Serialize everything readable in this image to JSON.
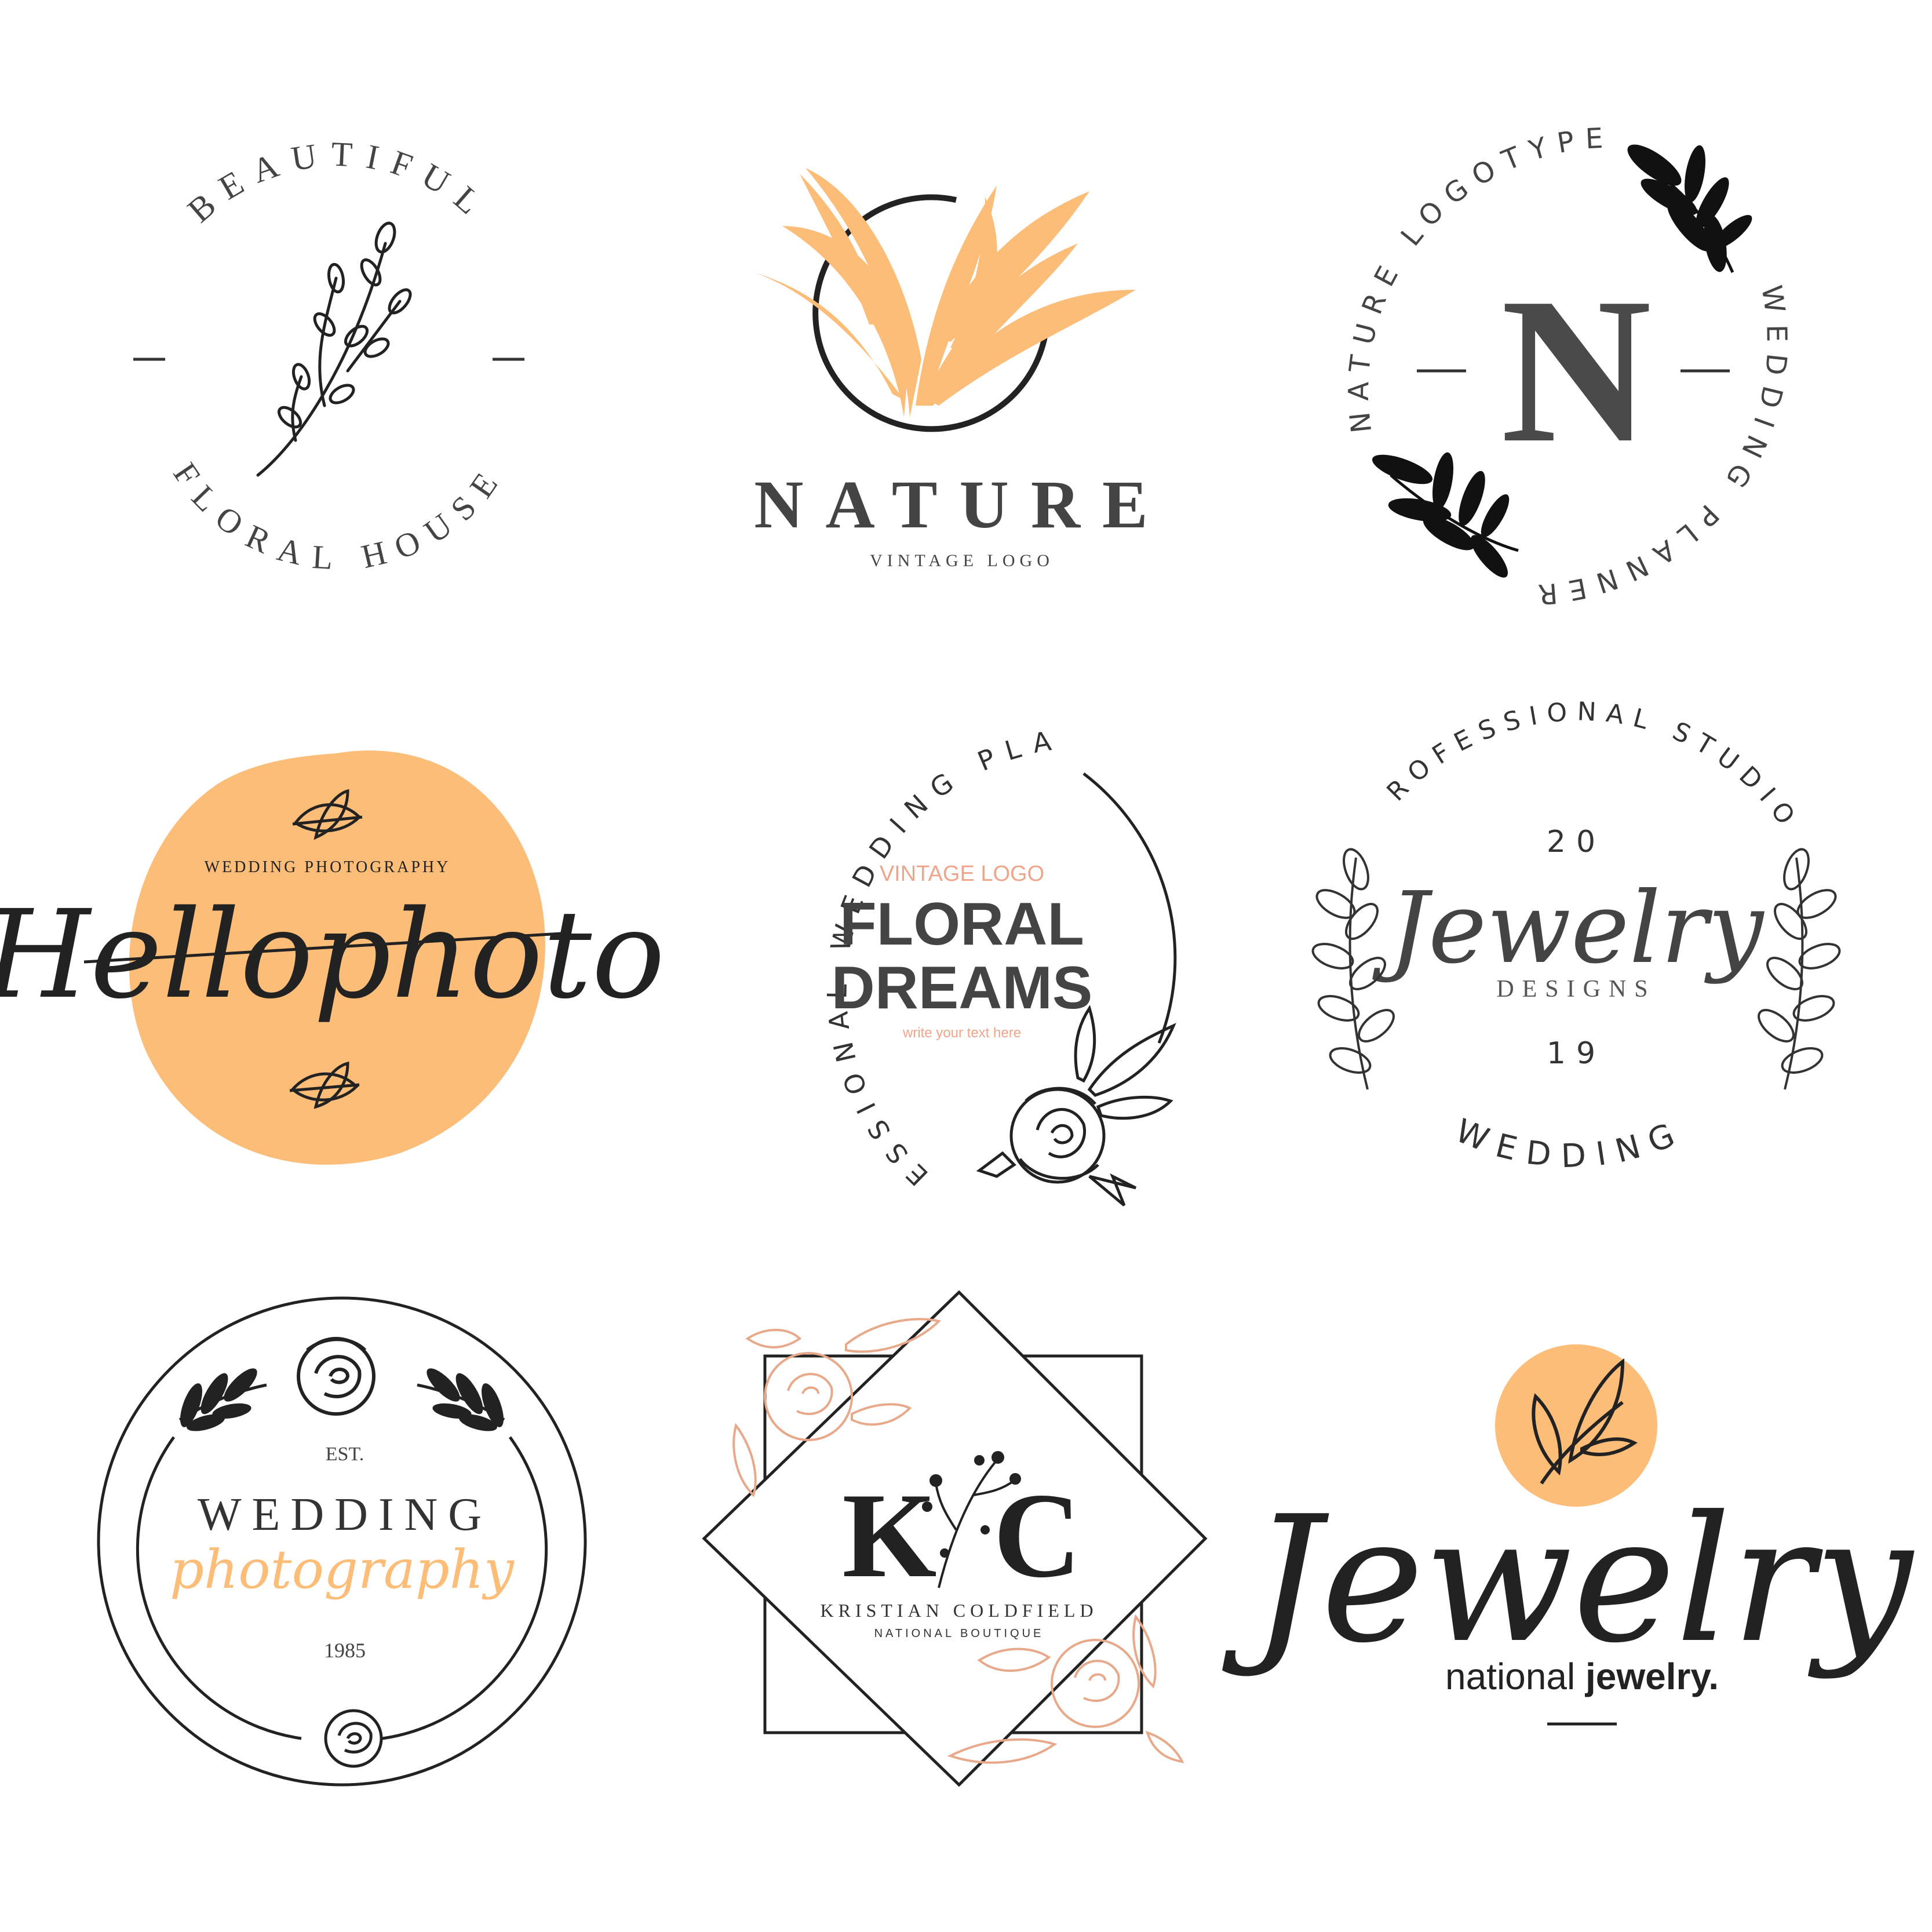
{
  "colors": {
    "ink": "#222222",
    "dark_gray": "#4a4a4a",
    "peach": "#fcbd79",
    "rose_gold": "#e8a88a",
    "salmon_text": "#f0a48a"
  },
  "logos": {
    "beautiful_floral_house": {
      "top_arc": "BEAUTIFUL",
      "bottom_arc": "FLORAL HOUSE",
      "icon": "branch-icon"
    },
    "nature_vintage": {
      "title": "NATURE",
      "subtitle": "VINTAGE LOGO",
      "icon": "leaves-icon"
    },
    "n_monogram": {
      "letter": "N",
      "left_arc": "NATURE LOGOTYPE",
      "right_arc": "WEDDING PLANNER",
      "icon": "leaf-sprig-icon"
    },
    "hellophoto": {
      "small_caption": "WEDDING PHOTOGRAPHY",
      "script_title": "Hellophoto",
      "icon": "leaf-pair-icon"
    },
    "floral_dreams": {
      "arc_text": "PROFESSIONAL WEDDING PLANNER",
      "kicker": "VINTAGE LOGO",
      "title_line1": "FLORAL",
      "title_line2": "DREAMS",
      "tagline": "write your text here",
      "icon": "rose-icon"
    },
    "jewelry_designs": {
      "top_arc": "PROFESSIONAL STUDIO",
      "year_top": "20",
      "script_title": "Jewelry",
      "subtitle": "DESIGNS",
      "year_bottom": "19",
      "bottom_arc": "WEDDING",
      "icon": "laurel-icon"
    },
    "wedding_photography": {
      "est": "EST.",
      "title": "WEDDING",
      "script_subtitle": "photography",
      "year": "1985",
      "icon": "rose-icon"
    },
    "kc_monogram": {
      "letter_left": "K",
      "letter_right": "C",
      "name": "KRISTIAN COLDFIELD",
      "subname": "NATIONAL BOUTIQUE",
      "icon": "floral-corner-icon"
    },
    "jewelry_national": {
      "script_title": "Jewelry",
      "tag_regular": "national ",
      "tag_bold": "jewelry.",
      "icon": "leaf-circle-icon"
    }
  }
}
